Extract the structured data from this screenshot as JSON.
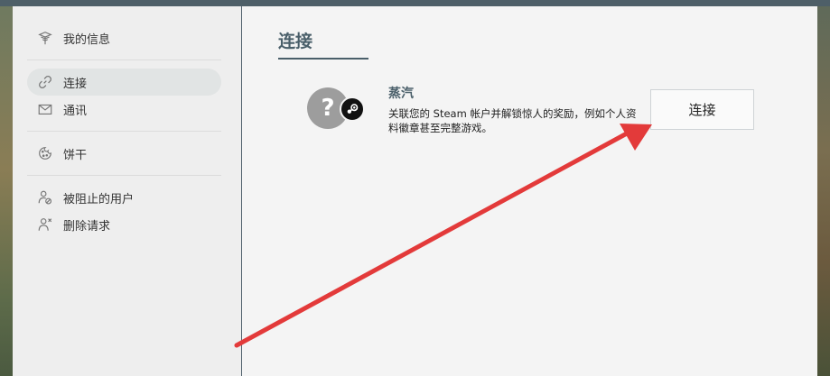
{
  "sidebar": {
    "items": [
      {
        "label": "我的信息",
        "icon": "gift-icon"
      },
      {
        "label": "连接",
        "icon": "link-icon"
      },
      {
        "label": "通讯",
        "icon": "mail-icon"
      },
      {
        "label": "饼干",
        "icon": "cookie-icon"
      },
      {
        "label": "被阻止的用户",
        "icon": "blocked-user-icon"
      },
      {
        "label": "删除请求",
        "icon": "remove-user-icon"
      }
    ]
  },
  "main": {
    "title": "连接",
    "connection": {
      "name": "蒸汽",
      "description": "关联您的 Steam 帐户并解锁惊人的奖励，例如个人资料徽章甚至完整游戏。",
      "button_label": "连接",
      "avatar_glyph": "?"
    }
  },
  "colors": {
    "accent": "#4a5f6a",
    "arrow": "#e33a3a",
    "topbar": "#4e5f68"
  }
}
